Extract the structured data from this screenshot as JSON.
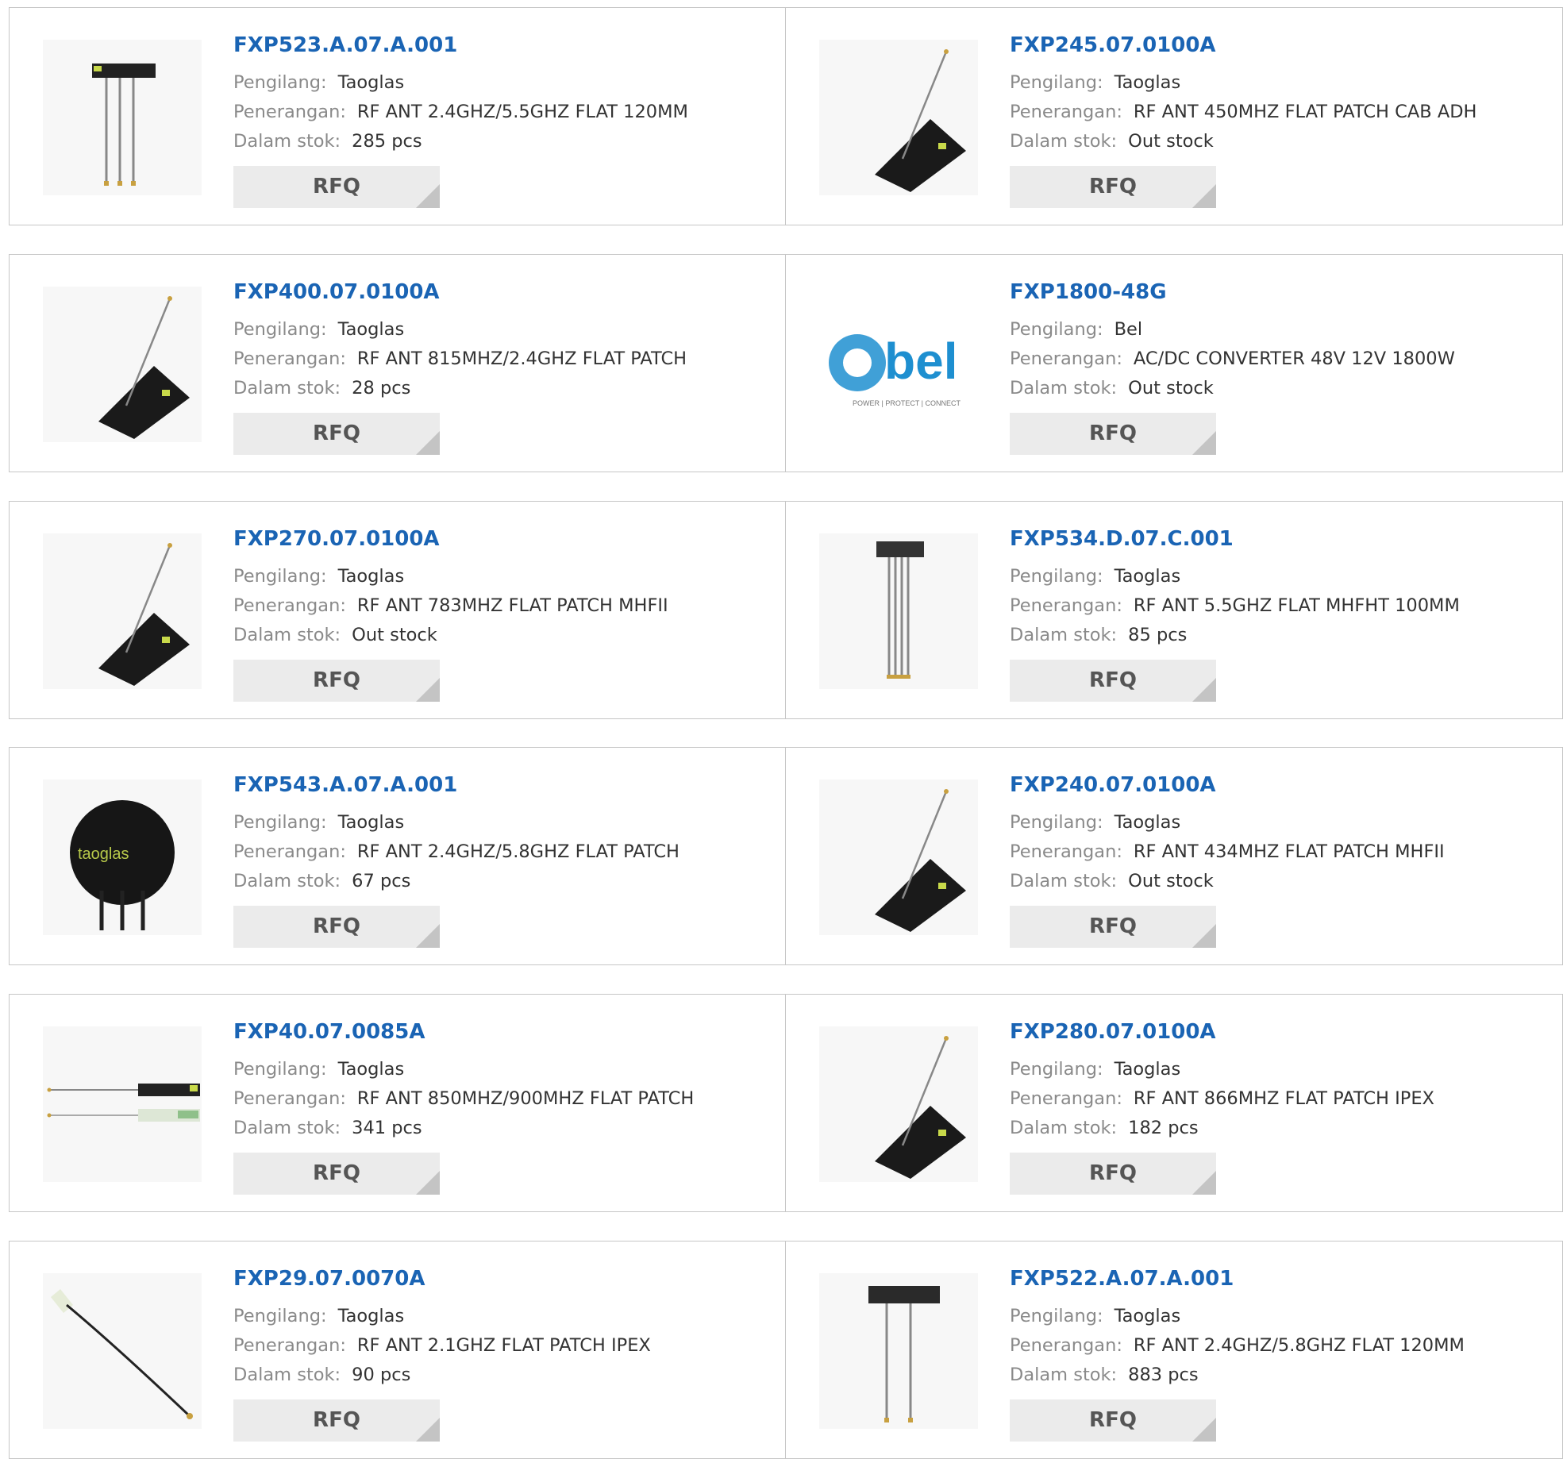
{
  "labels": {
    "manufacturer": "Pengilang:",
    "description": "Penerangan:",
    "stock": "Dalam stok:",
    "rfq": "RFQ"
  },
  "products": [
    {
      "pn": "FXP523.A.07.A.001",
      "manufacturer": "Taoglas",
      "description": "RF ANT 2.4GHZ/5.5GHZ FLAT 120MM",
      "stock": "285 pcs",
      "image": "antenna-strip-3-cables"
    },
    {
      "pn": "FXP245.07.0100A",
      "manufacturer": "Taoglas",
      "description": "RF ANT 450MHZ FLAT PATCH CAB ADH",
      "stock": "Out stock",
      "image": "flat-patch-antenna"
    },
    {
      "pn": "FXP400.07.0100A",
      "manufacturer": "Taoglas",
      "description": "RF ANT 815MHZ/2.4GHZ FLAT PATCH",
      "stock": "28 pcs",
      "image": "flat-patch-antenna"
    },
    {
      "pn": "FXP1800-48G",
      "manufacturer": "Bel",
      "description": "AC/DC CONVERTER 48V 12V 1800W",
      "stock": "Out stock",
      "image": "bel-logo",
      "logo_text": "bel",
      "logo_tagline": "POWER | PROTECT | CONNECT"
    },
    {
      "pn": "FXP270.07.0100A",
      "manufacturer": "Taoglas",
      "description": "RF ANT 783MHZ FLAT PATCH MHFII",
      "stock": "Out stock",
      "image": "flat-patch-antenna"
    },
    {
      "pn": "FXP534.D.07.C.001",
      "manufacturer": "Taoglas",
      "description": "RF ANT 5.5GHZ FLAT MHFHT 100MM",
      "stock": "85 pcs",
      "image": "antenna-strip-4-cables"
    },
    {
      "pn": "FXP543.A.07.A.001",
      "manufacturer": "Taoglas",
      "description": "RF ANT 2.4GHZ/5.8GHZ FLAT PATCH",
      "stock": "67 pcs",
      "image": "round-patch-antenna"
    },
    {
      "pn": "FXP240.07.0100A",
      "manufacturer": "Taoglas",
      "description": "RF ANT 434MHZ FLAT PATCH MHFII",
      "stock": "Out stock",
      "image": "flat-patch-antenna"
    },
    {
      "pn": "FXP40.07.0085A",
      "manufacturer": "Taoglas",
      "description": "RF ANT 850MHZ/900MHZ FLAT PATCH",
      "stock": "341 pcs",
      "image": "dual-strip-antenna"
    },
    {
      "pn": "FXP280.07.0100A",
      "manufacturer": "Taoglas",
      "description": "RF ANT 866MHZ FLAT PATCH IPEX",
      "stock": "182 pcs",
      "image": "flat-patch-antenna"
    },
    {
      "pn": "FXP29.07.0070A",
      "manufacturer": "Taoglas",
      "description": "RF ANT 2.1GHZ FLAT PATCH IPEX",
      "stock": "90 pcs",
      "image": "cable-antenna"
    },
    {
      "pn": "FXP522.A.07.A.001",
      "manufacturer": "Taoglas",
      "description": "RF ANT 2.4GHZ/5.8GHZ FLAT 120MM",
      "stock": "883 pcs",
      "image": "antenna-strip-2-cables"
    }
  ],
  "colors": {
    "part_number": "#1a64b4",
    "label": "#8a8a8a",
    "value": "#333333",
    "rfq_background": "#ebebeb",
    "rfq_corner": "#c4c4c4",
    "border": "#c6c6c6",
    "bel_blue": "#1e8fd0"
  }
}
